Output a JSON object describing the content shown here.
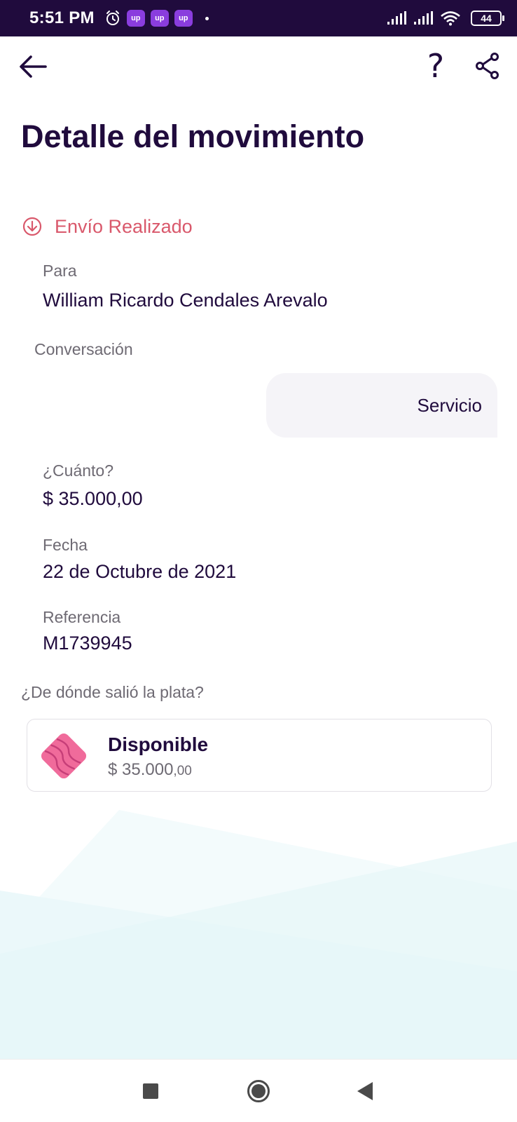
{
  "status_bar": {
    "time": "5:51 PM",
    "app_badges": [
      "up",
      "up",
      "up"
    ],
    "battery": "44",
    "icons": [
      "alarm-icon",
      "signal-icon",
      "signal-icon",
      "wifi-icon",
      "battery-icon"
    ]
  },
  "header": {
    "back_icon": "arrow-left-icon",
    "help_label": "?",
    "share_icon": "share-icon"
  },
  "page": {
    "title": "Detalle del movimiento"
  },
  "movement": {
    "status_icon": "arrow-down-circle-icon",
    "status_label": "Envío Realizado",
    "to_label": "Para",
    "to_value": "William Ricardo Cendales Arevalo",
    "conversation_label": "Conversación",
    "message": "Servicio",
    "amount_label": "¿Cuánto?",
    "amount_value": "$ 35.000,00",
    "date_label": "Fecha",
    "date_value": "22 de Octubre de 2021",
    "reference_label": "Referencia",
    "reference_value": "M1739945",
    "source_label": "¿De dónde salió la plata?"
  },
  "source_account": {
    "icon": "pocket-card-icon",
    "name": "Disponible",
    "balance_main": "$ 35.000",
    "balance_decimals": ",00"
  },
  "nav_bar": {
    "items": [
      "recents-icon",
      "home-icon",
      "back-icon"
    ]
  },
  "colors": {
    "primary": "#200b3d",
    "status_sent": "#d9586b",
    "label_gray": "#6e6a73",
    "status_bar_bg": "#200b3d",
    "account_pink": "#f06b9b"
  }
}
